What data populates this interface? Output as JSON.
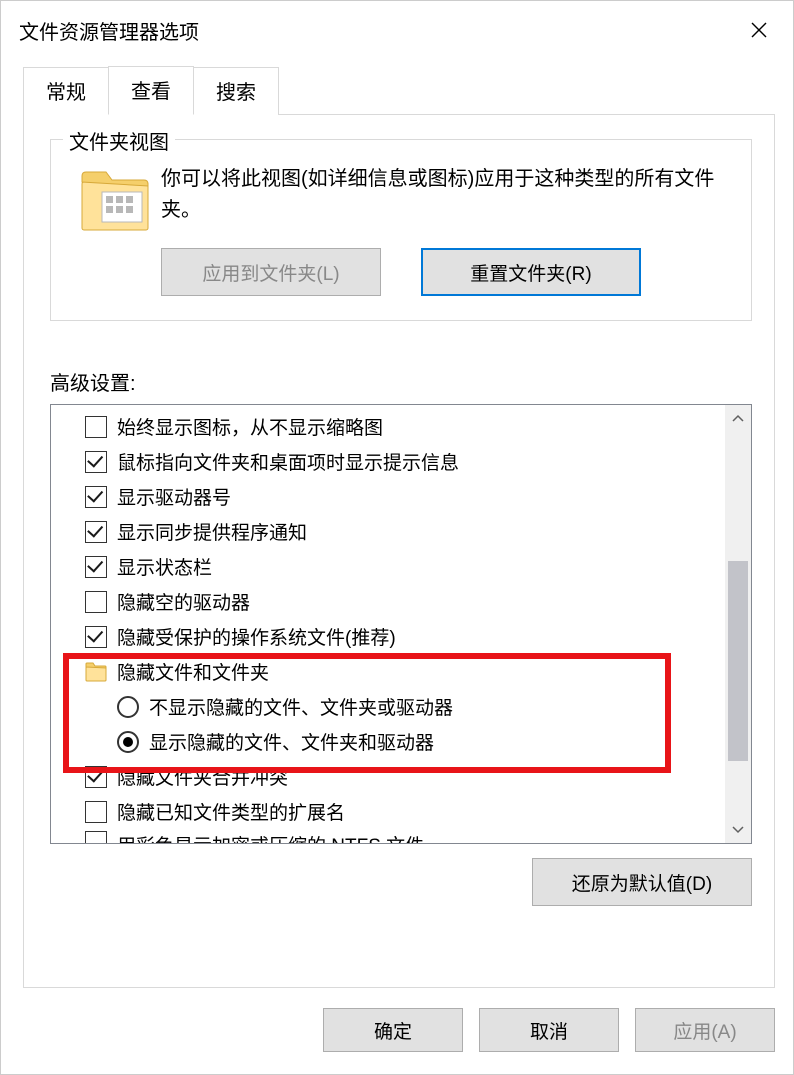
{
  "window": {
    "title": "文件资源管理器选项"
  },
  "tabs": {
    "general": "常规",
    "view": "查看",
    "search": "搜索"
  },
  "folderViews": {
    "groupTitle": "文件夹视图",
    "description": "你可以将此视图(如详细信息或图标)应用于这种类型的所有文件夹。",
    "applyBtn": "应用到文件夹(L)",
    "resetBtn": "重置文件夹(R)"
  },
  "advanced": {
    "label": "高级设置:",
    "items": [
      {
        "kind": "check",
        "checked": false,
        "label": "始终显示图标，从不显示缩略图"
      },
      {
        "kind": "check",
        "checked": true,
        "label": "鼠标指向文件夹和桌面项时显示提示信息"
      },
      {
        "kind": "check",
        "checked": true,
        "label": "显示驱动器号"
      },
      {
        "kind": "check",
        "checked": true,
        "label": "显示同步提供程序通知"
      },
      {
        "kind": "check",
        "checked": true,
        "label": "显示状态栏"
      },
      {
        "kind": "check",
        "checked": false,
        "label": "隐藏空的驱动器"
      },
      {
        "kind": "check",
        "checked": true,
        "label": "隐藏受保护的操作系统文件(推荐)"
      },
      {
        "kind": "folder",
        "label": "隐藏文件和文件夹"
      },
      {
        "kind": "radio",
        "selected": false,
        "label": "不显示隐藏的文件、文件夹或驱动器"
      },
      {
        "kind": "radio",
        "selected": true,
        "label": "显示隐藏的文件、文件夹和驱动器"
      },
      {
        "kind": "check",
        "checked": true,
        "label": "隐藏文件夹合并冲突"
      },
      {
        "kind": "check",
        "checked": false,
        "label": "隐藏已知文件类型的扩展名"
      },
      {
        "kind": "check",
        "checked": false,
        "label": "用彩色显示加密或压缩的 NTFS 文件",
        "cut": true
      }
    ],
    "restoreBtn": "还原为默认值(D)"
  },
  "buttons": {
    "ok": "确定",
    "cancel": "取消",
    "apply": "应用(A)"
  }
}
